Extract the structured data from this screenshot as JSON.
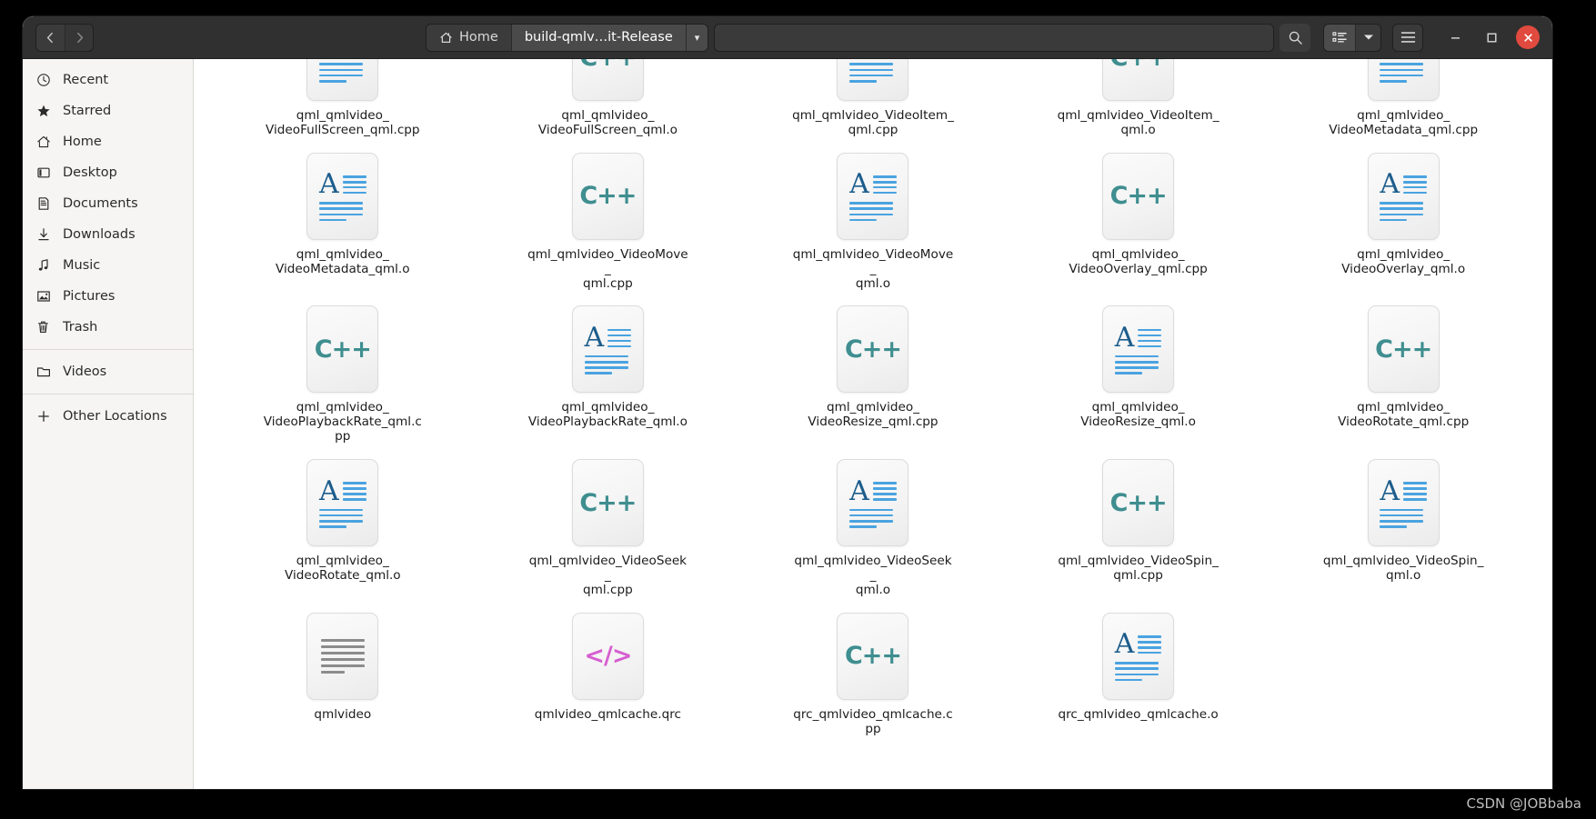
{
  "window": {
    "nav": {
      "back_label": "Back",
      "forward_label": "Forward"
    },
    "breadcrumbs": [
      {
        "label": "Home",
        "icon": "home-icon",
        "active": false
      },
      {
        "label": "build-qmlv…it-Release",
        "icon": "",
        "active": true
      }
    ],
    "breadcrumb_caret": "▾",
    "search": {
      "placeholder": "",
      "value": "",
      "icon": "search-icon"
    },
    "view_toggle": {
      "icon": "list-view-icon",
      "caret": "▾"
    },
    "menu": {
      "icon": "hamburger-menu-icon"
    },
    "controls": {
      "minimize": "−",
      "maximize": "□",
      "close": "✕"
    }
  },
  "sidebar": {
    "items": [
      {
        "label": "Recent",
        "icon": "clock-icon"
      },
      {
        "label": "Starred",
        "icon": "star-icon"
      },
      {
        "label": "Home",
        "icon": "home-icon"
      },
      {
        "label": "Desktop",
        "icon": "desktop-icon"
      },
      {
        "label": "Documents",
        "icon": "document-icon"
      },
      {
        "label": "Downloads",
        "icon": "download-icon"
      },
      {
        "label": "Music",
        "icon": "music-note-icon"
      },
      {
        "label": "Pictures",
        "icon": "picture-icon"
      },
      {
        "label": "Trash",
        "icon": "trash-icon"
      }
    ],
    "items_after_sep": [
      {
        "label": "Videos",
        "icon": "folder-icon"
      }
    ],
    "items_bottom": [
      {
        "label": "Other Locations",
        "icon": "plus-icon"
      }
    ]
  },
  "files": [
    {
      "name1": "qml_qmlvideo_",
      "name2": "VideoFullScreen_qml.cpp",
      "icon": "text-file-icon",
      "clipped_top": true
    },
    {
      "name1": "qml_qmlvideo_",
      "name2": "VideoFullScreen_qml.o",
      "icon": "cpp-file-icon",
      "clipped_top": true
    },
    {
      "name1": "qml_qmlvideo_VideoItem_",
      "name2": "qml.cpp",
      "icon": "text-file-icon",
      "clipped_top": true
    },
    {
      "name1": "qml_qmlvideo_VideoItem_",
      "name2": "qml.o",
      "icon": "cpp-file-icon",
      "clipped_top": true
    },
    {
      "name1": "qml_qmlvideo_",
      "name2": "VideoMetadata_qml.cpp",
      "icon": "text-file-icon",
      "clipped_top": true
    },
    {
      "name1": "qml_qmlvideo_",
      "name2": "VideoMetadata_qml.o",
      "icon": "text-file-icon",
      "clipped_top": false
    },
    {
      "name1": "qml_qmlvideo_VideoMove_",
      "name2": "qml.cpp",
      "icon": "cpp-file-icon",
      "clipped_top": false
    },
    {
      "name1": "qml_qmlvideo_VideoMove_",
      "name2": "qml.o",
      "icon": "text-file-icon",
      "clipped_top": false
    },
    {
      "name1": "qml_qmlvideo_",
      "name2": "VideoOverlay_qml.cpp",
      "icon": "cpp-file-icon",
      "clipped_top": false
    },
    {
      "name1": "qml_qmlvideo_",
      "name2": "VideoOverlay_qml.o",
      "icon": "text-file-icon",
      "clipped_top": false
    },
    {
      "name1": "qml_qmlvideo_",
      "name2": "VideoPlaybackRate_qml.cpp",
      "icon": "cpp-file-icon",
      "clipped_top": false
    },
    {
      "name1": "qml_qmlvideo_",
      "name2": "VideoPlaybackRate_qml.o",
      "icon": "text-file-icon",
      "clipped_top": false
    },
    {
      "name1": "qml_qmlvideo_",
      "name2": "VideoResize_qml.cpp",
      "icon": "cpp-file-icon",
      "clipped_top": false
    },
    {
      "name1": "qml_qmlvideo_",
      "name2": "VideoResize_qml.o",
      "icon": "text-file-icon",
      "clipped_top": false
    },
    {
      "name1": "qml_qmlvideo_",
      "name2": "VideoRotate_qml.cpp",
      "icon": "cpp-file-icon",
      "clipped_top": false
    },
    {
      "name1": "qml_qmlvideo_",
      "name2": "VideoRotate_qml.o",
      "icon": "text-file-icon",
      "clipped_top": false
    },
    {
      "name1": "qml_qmlvideo_VideoSeek_",
      "name2": "qml.cpp",
      "icon": "cpp-file-icon",
      "clipped_top": false
    },
    {
      "name1": "qml_qmlvideo_VideoSeek_",
      "name2": "qml.o",
      "icon": "text-file-icon",
      "clipped_top": false
    },
    {
      "name1": "qml_qmlvideo_VideoSpin_",
      "name2": "qml.cpp",
      "icon": "cpp-file-icon",
      "clipped_top": false
    },
    {
      "name1": "qml_qmlvideo_VideoSpin_",
      "name2": "qml.o",
      "icon": "text-file-icon",
      "clipped_top": false
    },
    {
      "name1": "qmlvideo",
      "name2": "",
      "icon": "executable-file-icon",
      "clipped_top": false
    },
    {
      "name1": "qmlvideo_qmlcache.qrc",
      "name2": "",
      "icon": "xml-file-icon",
      "clipped_top": false
    },
    {
      "name1": "qrc_qmlvideo_qmlcache.cpp",
      "name2": "",
      "icon": "cpp-file-icon",
      "clipped_top": false
    },
    {
      "name1": "qrc_qmlvideo_qmlcache.o",
      "name2": "",
      "icon": "text-file-icon",
      "clipped_top": false
    }
  ],
  "watermark": {
    "text": "CSDN @JOBbaba"
  },
  "colors": {
    "headerbar": "#303030",
    "sidebar": "#f6f5f4",
    "close_button": "#e04a3f",
    "cpp_icon": "#3f8e90",
    "text_icon_letter": "#1c5d8c",
    "text_icon_lines": "#4aa3e0",
    "xml_icon": "#d65fd0",
    "exec_icon": "#8c8c8c"
  }
}
